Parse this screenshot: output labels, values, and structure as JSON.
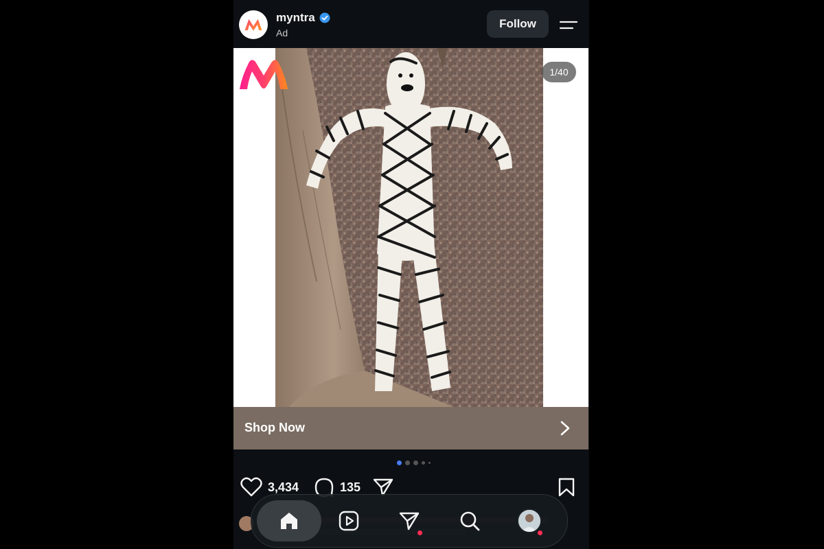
{
  "post": {
    "username": "myntra",
    "sponsored_label": "Ad",
    "follow_label": "Follow",
    "media_counter": "1/40",
    "cta_label": "Shop Now",
    "like_count": "3,434",
    "comment_count": "135"
  },
  "carousel": {
    "total_dots": 5,
    "active_index": 0
  },
  "nav": {
    "items": [
      "home-icon",
      "reels-icon",
      "direct-send-icon",
      "search-icon",
      "profile-avatar"
    ],
    "active": "home-icon"
  },
  "colors": {
    "background": "#0c1014",
    "cta_bar": "#7a6c62",
    "verified_badge": "#3897f0",
    "active_dot": "#4a7df5",
    "notification_dot": "#ff2d55"
  }
}
